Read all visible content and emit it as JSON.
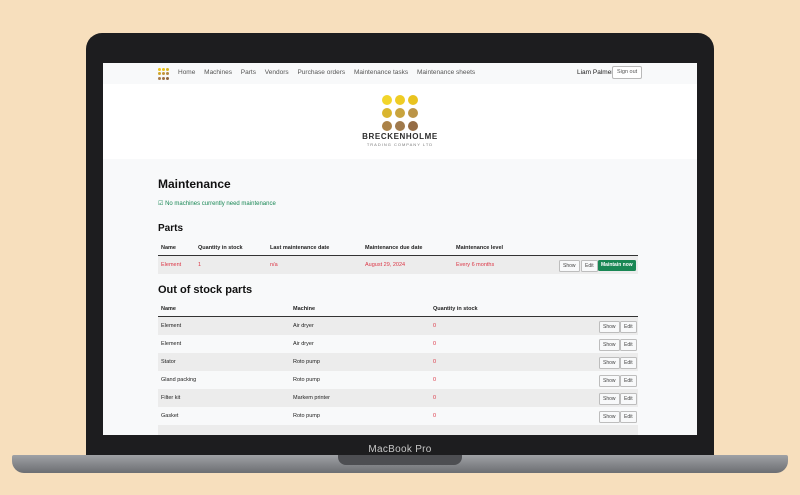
{
  "device": {
    "label": "MacBook Pro"
  },
  "nav": {
    "logo_colors": [
      "#f2c518",
      "#e8c21a",
      "#d9b420",
      "#cfa52a",
      "#c3953a",
      "#b48945",
      "#a97c4a",
      "#9d7045",
      "#8f6540"
    ],
    "links": [
      "Home",
      "Machines",
      "Parts",
      "Vendors",
      "Purchase orders",
      "Maintenance tasks",
      "Maintenance sheets"
    ],
    "user": "Liam Palmer",
    "sign_out": "Sign out"
  },
  "brand": {
    "name": "BRECKENHOLME",
    "subtitle": "TRADING COMPANY LTD",
    "dot_colors": [
      "#f2d52a",
      "#efcc24",
      "#e9c31f",
      "#d9b52e",
      "#c9a43d",
      "#bb9447",
      "#ab8247",
      "#a07a4c",
      "#946c45"
    ]
  },
  "page": {
    "title": "Maintenance",
    "status_icon": "check-square-icon",
    "status_message": "No machines currently need maintenance"
  },
  "parts": {
    "title": "Parts",
    "columns": [
      "Name",
      "Quantity in stock",
      "Last maintenance date",
      "Maintenance due date",
      "Maintenance level"
    ],
    "rows": [
      {
        "name": "Element",
        "quantity": "1",
        "last_date": "n/a",
        "due_date": "August 29, 2024",
        "level": "Every 6 months",
        "show": "Show",
        "edit": "Edit",
        "maintain": "Maintain now"
      }
    ]
  },
  "out_of_stock": {
    "title": "Out of stock parts",
    "columns": [
      "Name",
      "Machine",
      "Quantity in stock"
    ],
    "rows": [
      {
        "name": "Element",
        "machine": "Air dryer",
        "quantity": "0",
        "show": "Show",
        "edit": "Edit"
      },
      {
        "name": "Element",
        "machine": "Air dryer",
        "quantity": "0",
        "show": "Show",
        "edit": "Edit"
      },
      {
        "name": "Stator",
        "machine": "Roto pump",
        "quantity": "0",
        "show": "Show",
        "edit": "Edit"
      },
      {
        "name": "Gland packing",
        "machine": "Roto pump",
        "quantity": "0",
        "show": "Show",
        "edit": "Edit"
      },
      {
        "name": "Filter kit",
        "machine": "Markem printer",
        "quantity": "0",
        "show": "Show",
        "edit": "Edit"
      },
      {
        "name": "Gasket",
        "machine": "Roto pump",
        "quantity": "0",
        "show": "Show",
        "edit": "Edit"
      }
    ]
  }
}
